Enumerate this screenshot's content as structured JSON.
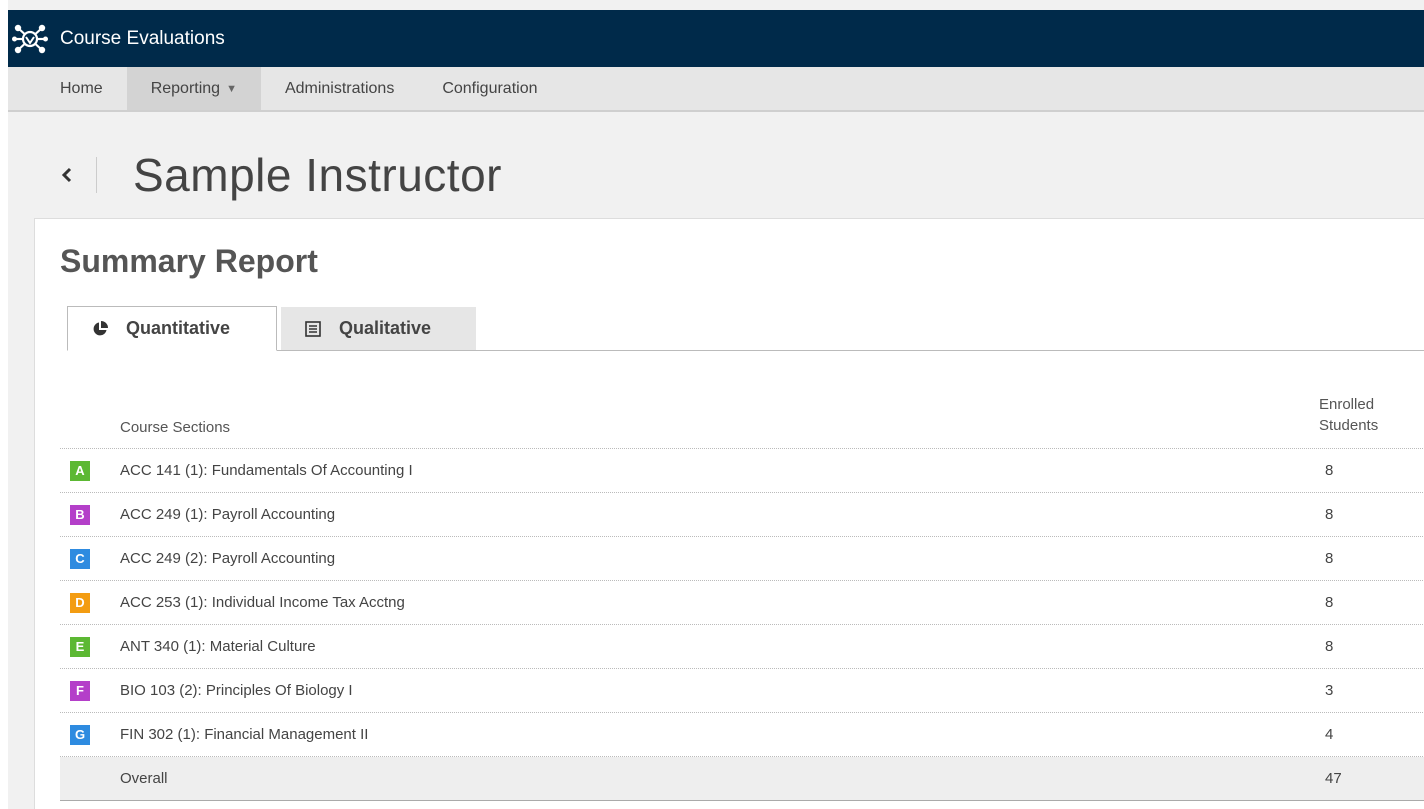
{
  "app": {
    "title": "Course Evaluations",
    "logo_icon": "network-logo-icon"
  },
  "nav": {
    "items": [
      {
        "label": "Home"
      },
      {
        "label": "Reporting",
        "caret": "▼"
      },
      {
        "label": "Administrations"
      },
      {
        "label": "Configuration"
      }
    ]
  },
  "page": {
    "back_glyph": "‹",
    "title": "Sample Instructor"
  },
  "report": {
    "title": "Summary Report",
    "tabs": [
      {
        "label": "Quantitative",
        "icon": "pie-chart-icon"
      },
      {
        "label": "Qualitative",
        "icon": "list-document-icon"
      }
    ]
  },
  "table": {
    "headers": {
      "sections": "Course Sections",
      "enrolled": "Enrolled Students"
    },
    "rows": [
      {
        "badge": "A",
        "color": "#5cb833",
        "course": "ACC 141 (1): Fundamentals Of Accounting I",
        "enrolled": "8"
      },
      {
        "badge": "B",
        "color": "#b43fc9",
        "course": "ACC 249 (1): Payroll Accounting",
        "enrolled": "8"
      },
      {
        "badge": "C",
        "color": "#2e8be0",
        "course": "ACC 249 (2): Payroll Accounting",
        "enrolled": "8"
      },
      {
        "badge": "D",
        "color": "#f39c12",
        "course": "ACC 253 (1): Individual Income Tax Acctng",
        "enrolled": "8"
      },
      {
        "badge": "E",
        "color": "#5cb833",
        "course": "ANT 340 (1): Material Culture",
        "enrolled": "8"
      },
      {
        "badge": "F",
        "color": "#b43fc9",
        "course": "BIO 103 (2): Principles Of Biology I",
        "enrolled": "3"
      },
      {
        "badge": "G",
        "color": "#2e8be0",
        "course": "FIN 302 (1): Financial Management II",
        "enrolled": "4"
      }
    ],
    "overall": {
      "label": "Overall",
      "enrolled": "47"
    }
  },
  "colors": {
    "topbar": "#002a4a",
    "nav": "#e6e6e6"
  }
}
